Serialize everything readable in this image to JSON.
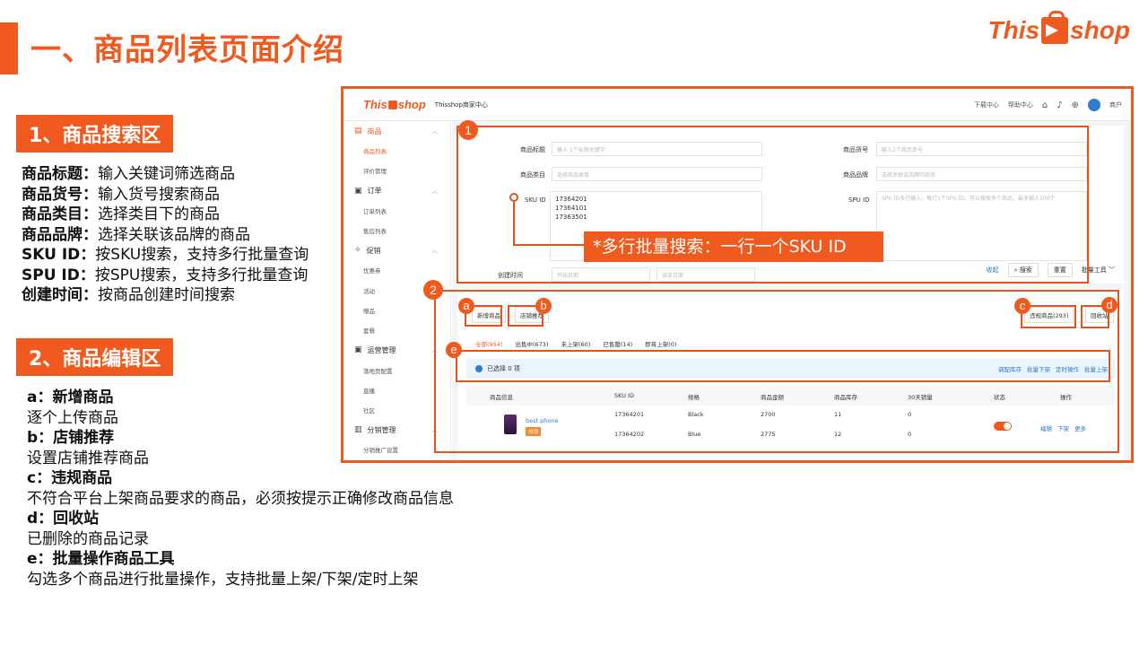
{
  "slide": {
    "title": "一、商品列表页面介绍",
    "brand_left": "This",
    "brand_right": "shop"
  },
  "section1": {
    "header": "1、商品搜索区",
    "lines": [
      {
        "label": "商品标题：",
        "text": "输入关键词筛选商品"
      },
      {
        "label": "商品货号：",
        "text": "输入货号搜索商品"
      },
      {
        "label": "商品类目：",
        "text": "选择类目下的商品"
      },
      {
        "label": "商品品牌：",
        "text": "选择关联该品牌的商品"
      },
      {
        "label": "SKU ID：",
        "text": "按SKU搜索，支持多行批量查询"
      },
      {
        "label": "SPU ID：",
        "text": "按SPU搜索，支持多行批量查询"
      },
      {
        "label": "创建时间：",
        "text": "按商品创建时间搜索"
      }
    ]
  },
  "section2": {
    "header": "2、商品编辑区",
    "items": [
      {
        "title": "a：新增商品",
        "desc": "逐个上传商品"
      },
      {
        "title": "b：店铺推荐",
        "desc": "设置店铺推荐商品"
      },
      {
        "title": "c：违规商品",
        "desc": "不符合平台上架商品要求的商品，必须按提示正确修改商品信息"
      },
      {
        "title": "d：回收站",
        "desc": "已删除的商品记录"
      },
      {
        "title": "e：批量操作商品工具",
        "desc": "勾选多个商品进行批量操作，支持批量上架/下架/定时上架"
      }
    ]
  },
  "callout": "*多行批量搜索：一行一个SKU ID",
  "annotations": {
    "num1": "1",
    "num2": "2",
    "a": "a",
    "b": "b",
    "c": "c",
    "d": "d",
    "e": "e"
  },
  "screenshot": {
    "brand_left": "This",
    "brand_right": "shop",
    "store": "Thisshop商家中心",
    "nav": [
      "下载中心",
      "帮助中心"
    ],
    "user": "商户",
    "sidebar": [
      {
        "type": "group",
        "icon": "▤",
        "label": "商品",
        "active": true
      },
      {
        "type": "item",
        "label": "商品列表",
        "active": true
      },
      {
        "type": "item",
        "label": "评价管理"
      },
      {
        "type": "group",
        "icon": "▣",
        "label": "订单"
      },
      {
        "type": "item",
        "label": "订单列表"
      },
      {
        "type": "item",
        "label": "售后列表"
      },
      {
        "type": "group",
        "icon": "✧",
        "label": "促销"
      },
      {
        "type": "item",
        "label": "优惠券"
      },
      {
        "type": "item",
        "label": "活动"
      },
      {
        "type": "item",
        "label": "赠品"
      },
      {
        "type": "item",
        "label": "套餐"
      },
      {
        "type": "group",
        "icon": "▣",
        "label": "运营管理"
      },
      {
        "type": "item",
        "label": "落地页配置"
      },
      {
        "type": "item",
        "label": "直播"
      },
      {
        "type": "item",
        "label": "社区"
      },
      {
        "type": "group",
        "icon": "▥",
        "label": "分销管理"
      },
      {
        "type": "item",
        "label": "分销推广设置"
      }
    ],
    "search": {
      "title_label": "商品标题",
      "title_ph": "输入 1个标题关键字",
      "sku_code_label": "商品货号",
      "sku_code_ph": "输入1个商品货号",
      "category_label": "商品类目",
      "category_ph": "选择商品类目",
      "brand_label": "商品品牌",
      "brand_ph": "选择关联该品牌的商品",
      "sku_label": "SKU ID",
      "sku_values": [
        "17364201",
        "17364101",
        "17363501"
      ],
      "spu_label": "SPU ID",
      "spu_ph": "SPU ID多行输入，每行1个SPU ID，可以搜索多个商品，最多输入100个",
      "time_label": "创建时间",
      "time_start": "开始日期",
      "time_end": "结束日期",
      "collapse": "收起",
      "search_btn": "搜索",
      "reset_btn": "重置",
      "batch_tool": "批量工具"
    },
    "list": {
      "add_btn": "新增商品",
      "recommend_btn": "店铺推荐",
      "violation_btn": "违规商品(293)",
      "recycle_btn": "回收站",
      "tabs": [
        "全部(954)",
        "出售中(673)",
        "未上架(60)",
        "已售罄(14)",
        "即将上架(0)"
      ],
      "selected": "已选择 0 项",
      "bulk_ops": [
        "调配库存",
        "批量下架",
        "定时操作",
        "批量上架"
      ],
      "headers": [
        "商品信息",
        "SKU ID",
        "规格",
        "商品金额",
        "商品库存",
        "30天销量",
        "状态",
        "操作"
      ],
      "row": {
        "name": "best phone",
        "tag": "热销",
        "skus": [
          "17364201",
          "17364202"
        ],
        "specs": [
          "Black",
          "Blue"
        ],
        "prices": [
          "2700",
          "2775"
        ],
        "stock": [
          "11",
          "12"
        ],
        "sales": [
          "0",
          "0"
        ],
        "ops": [
          "编辑",
          "下架",
          "更多"
        ]
      }
    }
  }
}
